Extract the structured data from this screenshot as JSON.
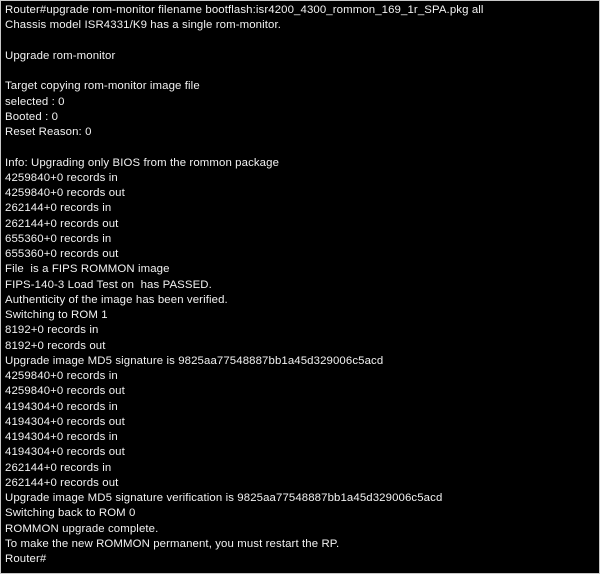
{
  "terminal": {
    "background_color": "#000000",
    "text_color": "#f2f2f2",
    "border_color": "#c8c8c8",
    "prompt": "Router#",
    "lines": [
      "Router#upgrade rom-monitor filename bootflash:isr4200_4300_rommon_169_1r_SPA.pkg all",
      "Chassis model ISR4331/K9 has a single rom-monitor.",
      "",
      "Upgrade rom-monitor",
      "",
      "Target copying rom-monitor image file",
      "selected : 0",
      "Booted : 0",
      "Reset Reason: 0",
      "",
      "Info: Upgrading only BIOS from the rommon package",
      "4259840+0 records in",
      "4259840+0 records out",
      "262144+0 records in",
      "262144+0 records out",
      "655360+0 records in",
      "655360+0 records out",
      "File  is a FIPS ROMMON image",
      "FIPS-140-3 Load Test on  has PASSED.",
      "Authenticity of the image has been verified.",
      "Switching to ROM 1",
      "8192+0 records in",
      "8192+0 records out",
      "Upgrade image MD5 signature is 9825aa77548887bb1a45d329006c5acd",
      "4259840+0 records in",
      "4259840+0 records out",
      "4194304+0 records in",
      "4194304+0 records out",
      "4194304+0 records in",
      "4194304+0 records out",
      "262144+0 records in",
      "262144+0 records out",
      "Upgrade image MD5 signature verification is 9825aa77548887bb1a45d329006c5acd",
      "Switching back to ROM 0",
      "ROMMON upgrade complete.",
      "To make the new ROMMON permanent, you must restart the RP.",
      "Router#"
    ]
  }
}
